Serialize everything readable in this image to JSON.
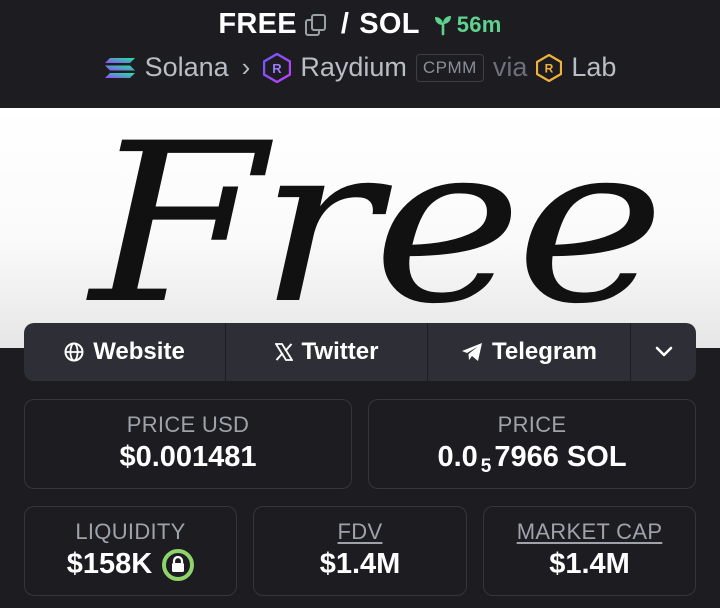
{
  "header": {
    "base_token": "FREE",
    "separator": "/",
    "quote_token": "SOL",
    "age": "56m",
    "chain": "Solana",
    "dex": "Raydium",
    "pool_type": "CPMM",
    "via_label": "via",
    "launchpad": "Lab"
  },
  "banner": {
    "text": "Free"
  },
  "links": {
    "website": "Website",
    "twitter": "Twitter",
    "telegram": "Telegram"
  },
  "stats": {
    "price_usd_label": "PRICE USD",
    "price_usd": "$0.001481",
    "price_label": "PRICE",
    "price_prefix": "0.0",
    "price_zeros": "5",
    "price_suffix": "7966 SOL",
    "liquidity_label": "LIQUIDITY",
    "liquidity": "$158K",
    "fdv_label": "FDV",
    "fdv": "$1.4M",
    "mcap_label": "MARKET CAP",
    "mcap": "$1.4M"
  },
  "colors": {
    "background": "#1c1c21",
    "age_green": "#5fd38d",
    "lock_green": "#8fd36b",
    "card_border": "#35363d"
  },
  "icons": [
    "copy-icon",
    "seedling-icon",
    "solana-icon",
    "raydium-icon",
    "lab-icon",
    "globe-icon",
    "x-icon",
    "telegram-icon",
    "chevron-down-icon",
    "lock-icon"
  ]
}
